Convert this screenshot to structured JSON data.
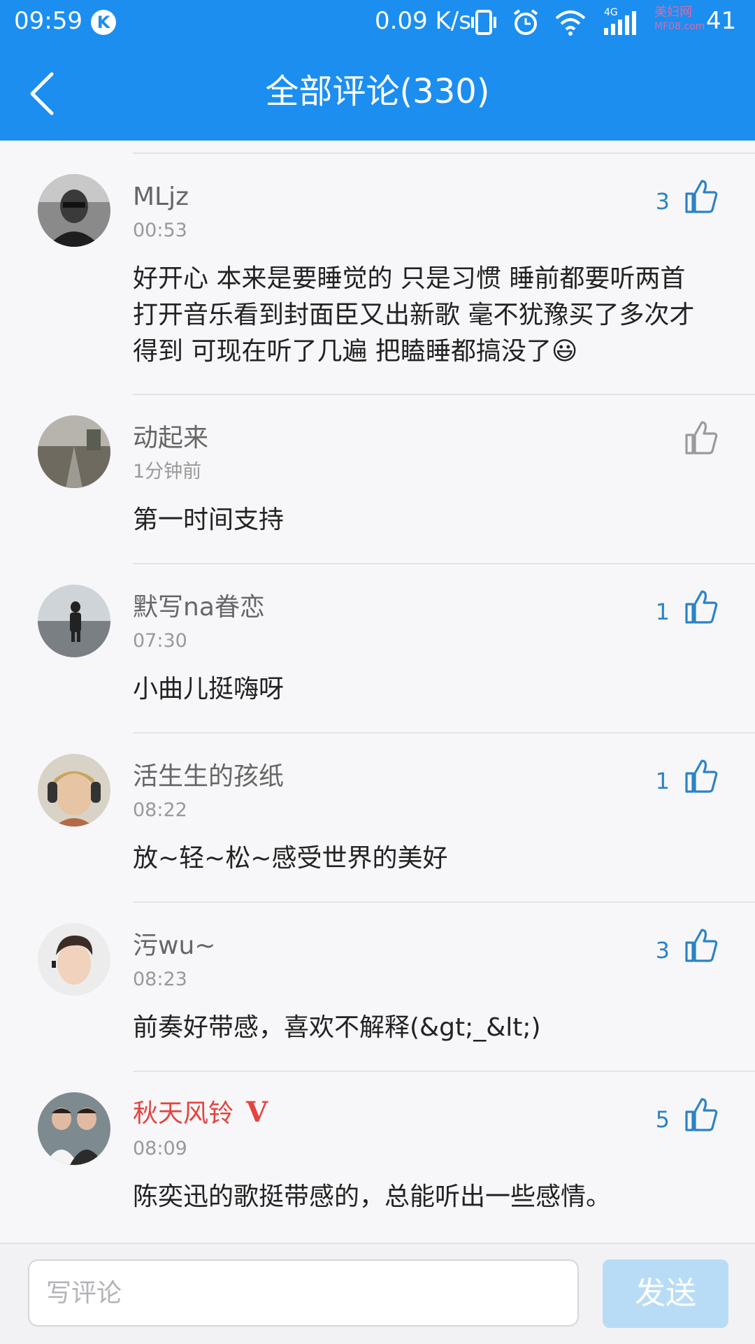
{
  "status_bar": {
    "time": "09:59",
    "app_badge": "K",
    "net_speed": "0.09 K/s",
    "network": "4G",
    "battery": "41",
    "watermark_line1": "美妇网",
    "watermark_line2": "MF08.com"
  },
  "header": {
    "title": "全部评论(330)"
  },
  "comments": [
    {
      "user": "MLjz",
      "time": "00:53",
      "text": "好开心 本来是要睡觉的 只是习惯 睡前都要听两首 打开音乐看到封面臣又出新歌 毫不犹豫买了多次才得到 可现在听了几遍 把瞌睡都搞没了😃",
      "likes": "3"
    },
    {
      "user": "动起来",
      "time": "1分钟前",
      "text": "第一时间支持",
      "likes": ""
    },
    {
      "user": "默写na眷恋",
      "time": "07:30",
      "text": "小曲儿挺嗨呀",
      "likes": "1"
    },
    {
      "user": "活生生的孩纸",
      "time": "08:22",
      "text": "放~轻~松~感受世界的美好",
      "likes": "1"
    },
    {
      "user": "污wu~",
      "time": "08:23",
      "text": "前奏好带感，喜欢不解释(&gt;_&lt;)",
      "likes": "3"
    },
    {
      "user": "秋天风铃",
      "badge": "V",
      "time": "08:09",
      "text": "陈奕迅的歌挺带感的，总能听出一些感情。",
      "likes": "5"
    }
  ],
  "composer": {
    "placeholder": "写评论",
    "send_label": "发送"
  },
  "colors": {
    "primary": "#1b8ef0",
    "like_active": "#2b83c6",
    "like_inactive": "#9a9a9a",
    "vip_name": "#e4443f",
    "send_disabled": "#b9dcf6"
  }
}
